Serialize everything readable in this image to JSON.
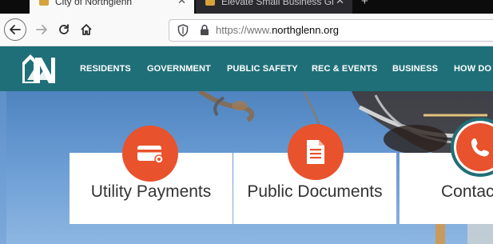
{
  "browser": {
    "tabs": [
      {
        "title": "City of Northglenn",
        "active": true
      },
      {
        "title": "Elevate Small Business Grant (E",
        "active": false
      }
    ],
    "new_tab_symbol": "+",
    "close_symbol": "✕",
    "url_prefix": "https://www.",
    "url_domain": "northglenn.org"
  },
  "site": {
    "nav": [
      "RESIDENTS",
      "GOVERNMENT",
      "PUBLIC SAFETY",
      "REC & EVENTS",
      "BUSINESS",
      "HOW DO"
    ],
    "cards": [
      "Utility Payments",
      "Public Documents",
      "Contac"
    ]
  },
  "colors": {
    "header": "#1f6f78",
    "accent": "#e8522c"
  },
  "icons": {
    "utility": "credit-card-icon",
    "documents": "document-icon",
    "contact": "phone-icon"
  }
}
